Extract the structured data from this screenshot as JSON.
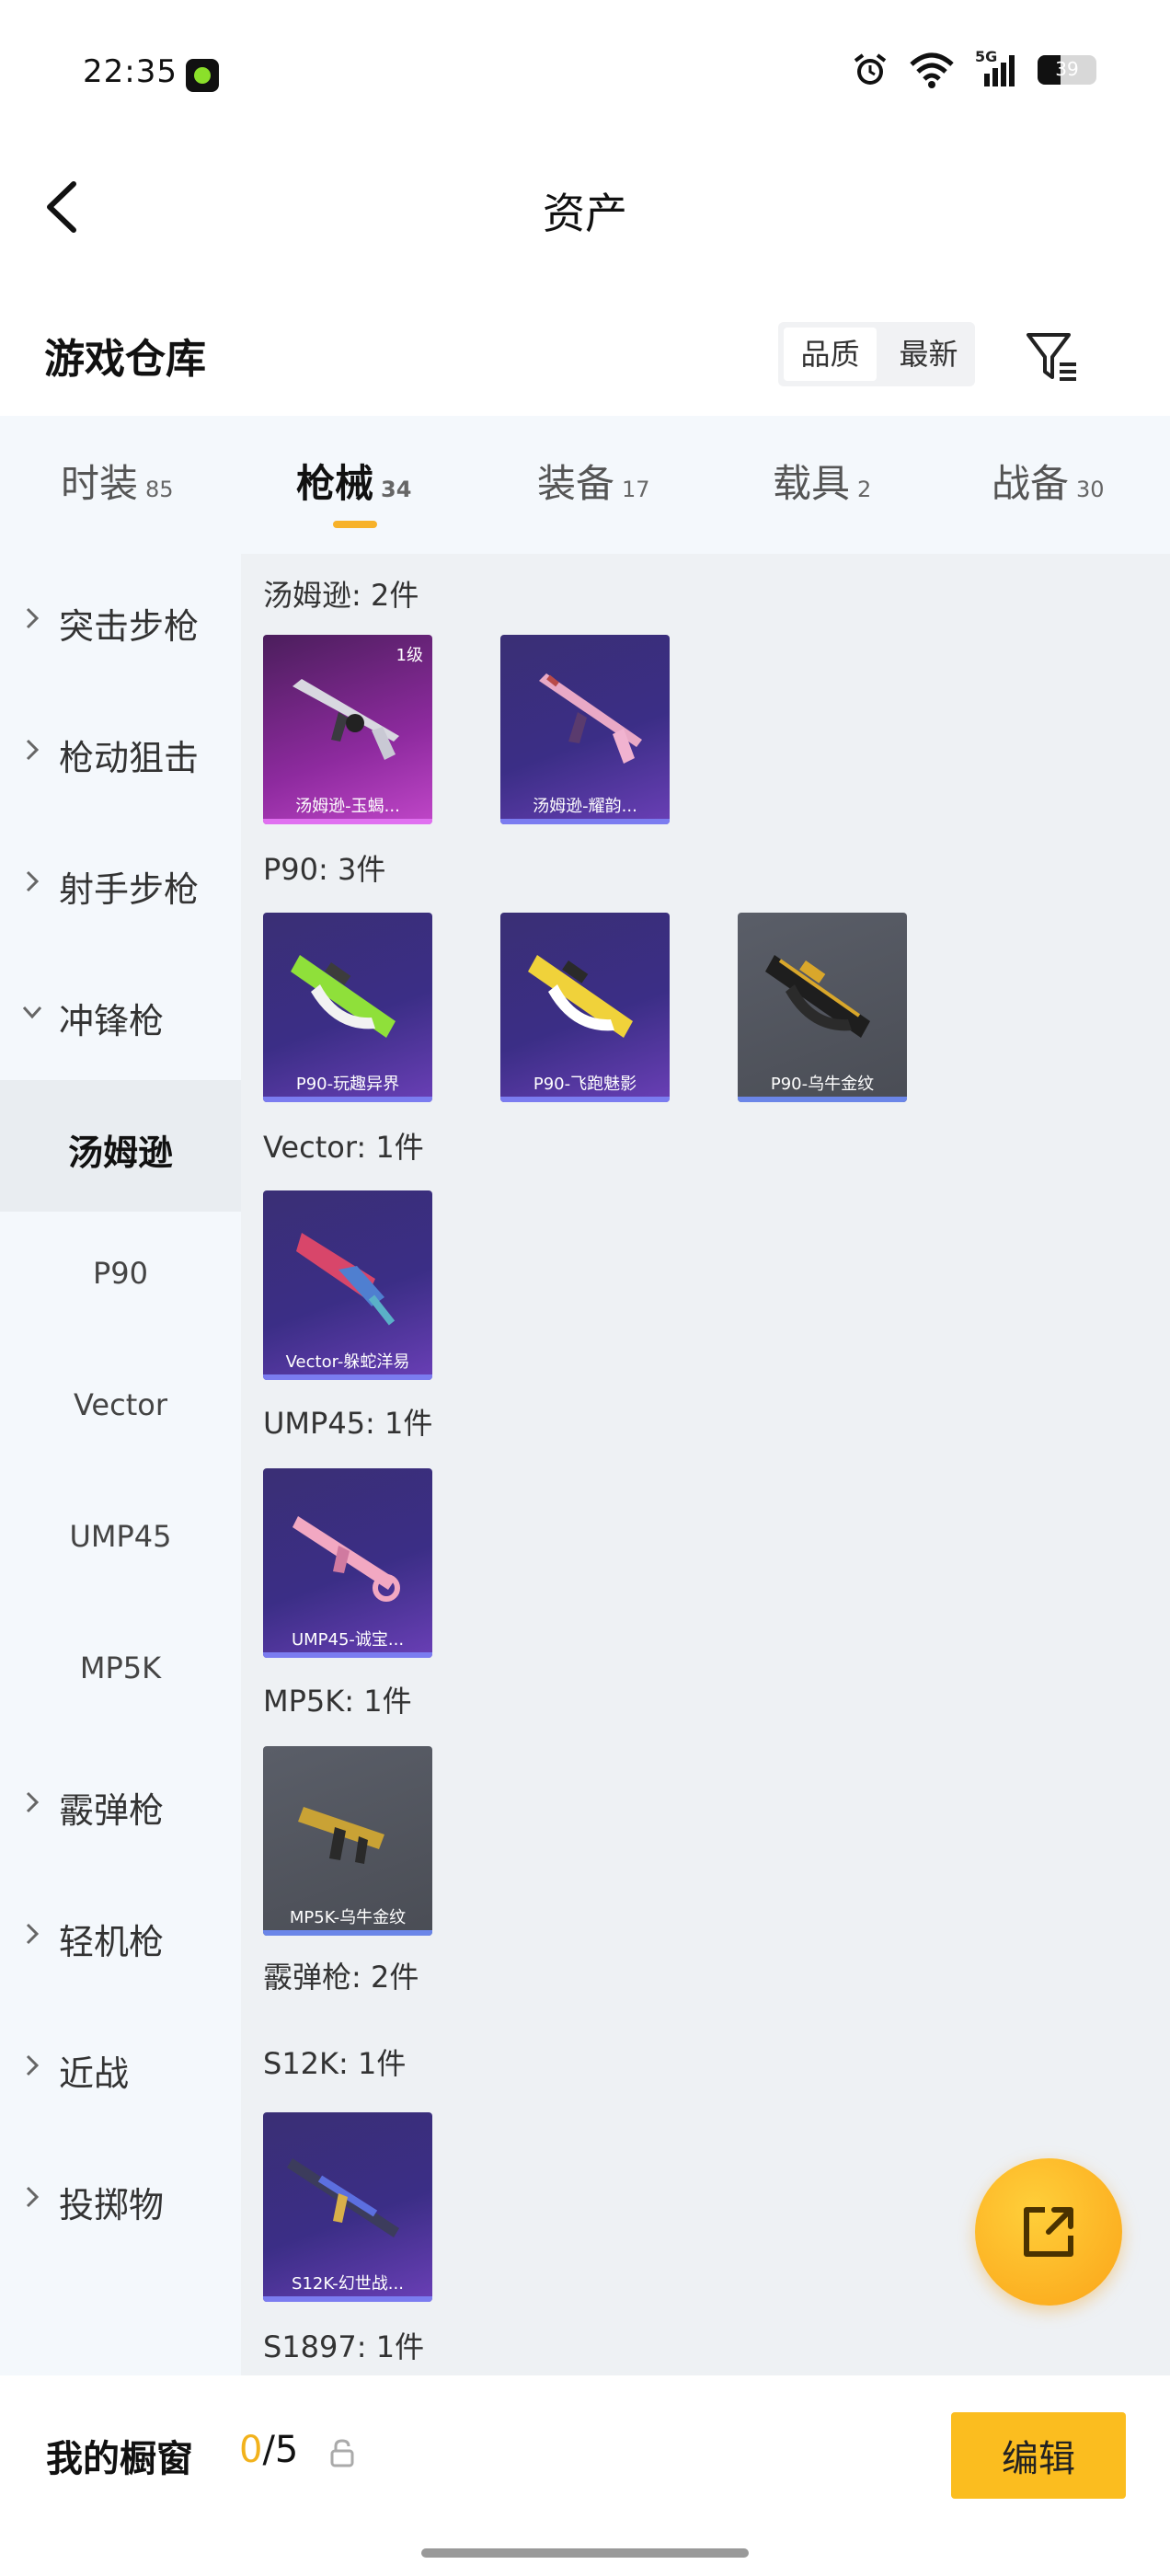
{
  "status_bar": {
    "time": "22:35",
    "network": "5G",
    "battery": "39"
  },
  "header": {
    "title": "资产"
  },
  "warehouse": {
    "title": "游戏仓库",
    "sort_options": [
      "品质",
      "最新"
    ]
  },
  "tabs": [
    {
      "label": "时装",
      "count": "85"
    },
    {
      "label": "枪械",
      "count": "34"
    },
    {
      "label": "装备",
      "count": "17"
    },
    {
      "label": "载具",
      "count": "2"
    },
    {
      "label": "战备",
      "count": "30"
    }
  ],
  "sidebar": {
    "items": [
      {
        "label": "突击步枪"
      },
      {
        "label": "枪动狙击"
      },
      {
        "label": "射手步枪"
      },
      {
        "label": "冲锋枪"
      },
      {
        "label": "汤姆逊"
      },
      {
        "label": "P90"
      },
      {
        "label": "Vector"
      },
      {
        "label": "UMP45"
      },
      {
        "label": "MP5K"
      },
      {
        "label": "霰弹枪"
      },
      {
        "label": "轻机枪"
      },
      {
        "label": "近战"
      },
      {
        "label": "投掷物"
      }
    ]
  },
  "content": {
    "groups": [
      {
        "label": "汤姆逊: 2件"
      },
      {
        "label": "P90: 3件"
      },
      {
        "label": "Vector: 1件"
      },
      {
        "label": "UMP45: 1件"
      },
      {
        "label": "MP5K: 1件"
      },
      {
        "label": "霰弹枪: 2件"
      },
      {
        "label": "S12K: 1件"
      },
      {
        "label": "S1897: 1件"
      }
    ],
    "cards": [
      {
        "caption": "汤姆逊-玉蝎...",
        "level": "1级"
      },
      {
        "caption": "汤姆逊-耀韵..."
      },
      {
        "caption": "P90-玩趣异界"
      },
      {
        "caption": "P90-飞跑魅影"
      },
      {
        "caption": "P90-乌牛金纹"
      },
      {
        "caption": "Vector-躲蛇洋易"
      },
      {
        "caption": "UMP45-诚宝..."
      },
      {
        "caption": "MP5K-乌牛金纹"
      },
      {
        "caption": "S12K-幻世战..."
      }
    ]
  },
  "bottom": {
    "label": "我的橱窗",
    "current": "0",
    "total": "/5",
    "edit_label": "编辑"
  },
  "colors": {
    "accent": "#fbbd1f",
    "sidebar_bg": "#f4f8fc",
    "content_bg": "#eef1f4"
  }
}
